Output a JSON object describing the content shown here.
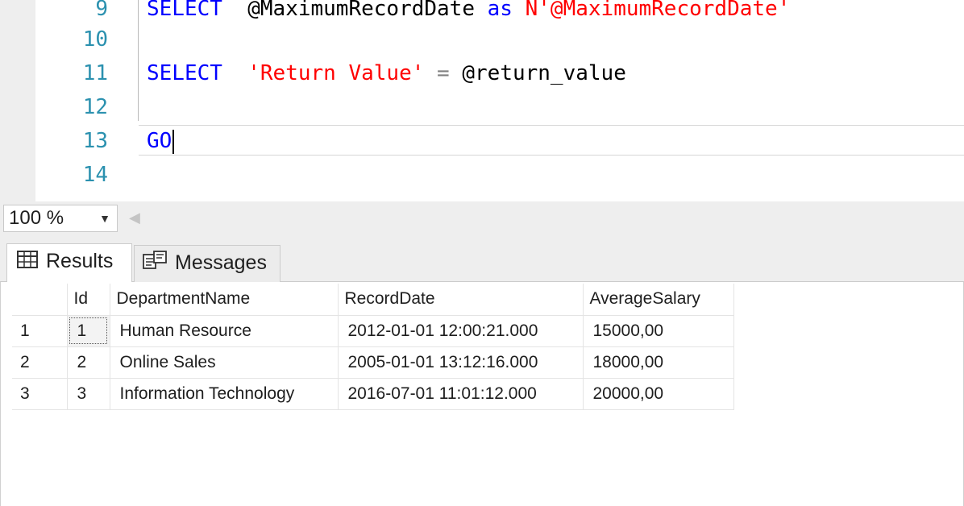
{
  "editor": {
    "lines": [
      {
        "num": "9",
        "tokens": [
          {
            "t": "SELECT",
            "c": "kw"
          },
          {
            "t": "  @MaximumRecordDate ",
            "c": "plain"
          },
          {
            "t": "as",
            "c": "kw"
          },
          {
            "t": " N'@MaximumRecordDate'",
            "c": "str"
          }
        ]
      },
      {
        "num": "10",
        "tokens": []
      },
      {
        "num": "11",
        "tokens": [
          {
            "t": "SELECT",
            "c": "kw"
          },
          {
            "t": "  ",
            "c": "plain"
          },
          {
            "t": "'Return Value'",
            "c": "str"
          },
          {
            "t": " = ",
            "c": "op"
          },
          {
            "t": "@return_value",
            "c": "plain"
          }
        ]
      },
      {
        "num": "12",
        "tokens": []
      },
      {
        "num": "13",
        "tokens": [
          {
            "t": "GO",
            "c": "kw"
          }
        ],
        "caret": true
      },
      {
        "num": "14",
        "tokens": []
      }
    ]
  },
  "zoom": {
    "value": "100 %"
  },
  "tabs": {
    "results_label": "Results",
    "messages_label": "Messages"
  },
  "results": {
    "columns": [
      "",
      "Id",
      "DepartmentName",
      "RecordDate",
      "AverageSalary"
    ],
    "rows": [
      [
        "1",
        "1",
        "Human Resource",
        "2012-01-01 12:00:21.000",
        "15000,00"
      ],
      [
        "2",
        "2",
        "Online Sales",
        "2005-01-01 13:12:16.000",
        "18000,00"
      ],
      [
        "3",
        "3",
        "Information Technology",
        "2016-07-01 11:01:12.000",
        "20000,00"
      ]
    ]
  },
  "colors": {
    "keyword": "#0000ff",
    "string": "#ff0000",
    "line_number": "#2b91af",
    "panel_bg": "#eeeeee"
  },
  "icons": {
    "results_tab": "grid-icon",
    "messages_tab": "messages-icon",
    "zoom_dropdown": "chevron-down-icon",
    "scroll_left": "arrow-left-icon"
  }
}
